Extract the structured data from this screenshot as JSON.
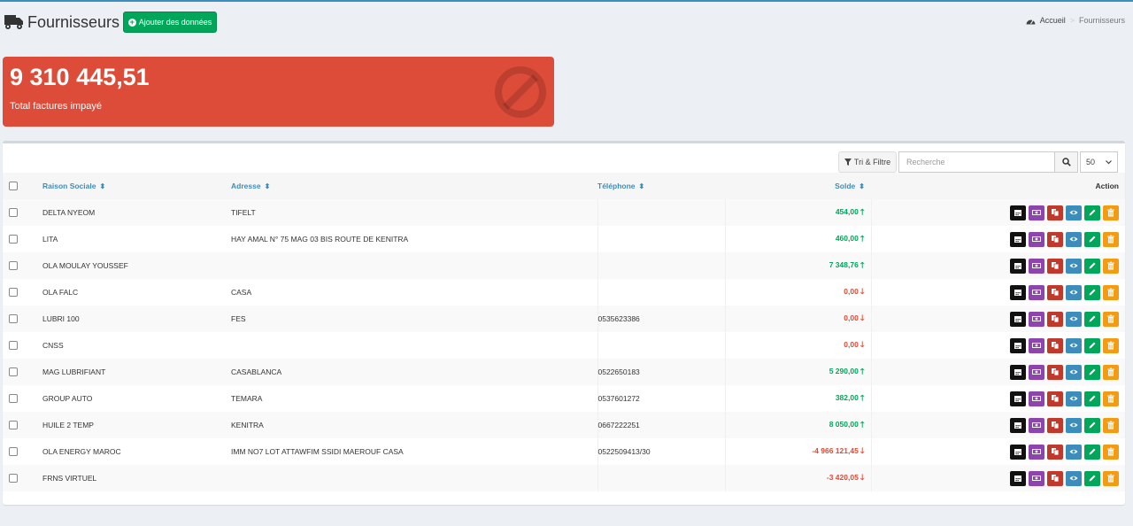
{
  "header": {
    "title": "Fournisseurs",
    "add_button": "Ajouter des données",
    "breadcrumb": {
      "home": "Accueil",
      "current": "Fournisseurs"
    }
  },
  "stat": {
    "value": "9 310 445,51",
    "label": "Total factures impayé"
  },
  "toolbar": {
    "filter_label": "Tri & Filtre",
    "search_placeholder": "Recherche",
    "per_page": "50"
  },
  "table": {
    "headers": {
      "raison": "Raison Sociale",
      "adresse": "Adresse",
      "telephone": "Téléphone",
      "solde": "Solde",
      "action": "Action"
    },
    "rows": [
      {
        "raison": "DELTA NYEOM",
        "adresse": "TIFELT",
        "telephone": "",
        "solde": "454,00",
        "trend": "up"
      },
      {
        "raison": "LITA",
        "adresse": "HAY AMAL N° 75 MAG 03 BIS ROUTE DE KENITRA",
        "telephone": "",
        "solde": "460,00",
        "trend": "up"
      },
      {
        "raison": "OLA MOULAY YOUSSEF",
        "adresse": "",
        "telephone": "",
        "solde": "7 348,76",
        "trend": "up"
      },
      {
        "raison": "OLA FALC",
        "adresse": "CASA",
        "telephone": "",
        "solde": "0,00",
        "trend": "down"
      },
      {
        "raison": "LUBRI 100",
        "adresse": "FES",
        "telephone": "0535623386",
        "solde": "0,00",
        "trend": "down"
      },
      {
        "raison": "CNSS",
        "adresse": "",
        "telephone": "",
        "solde": "0,00",
        "trend": "down"
      },
      {
        "raison": "MAG LUBRIFIANT",
        "adresse": "CASABLANCA",
        "telephone": "0522650183",
        "solde": "5 290,00",
        "trend": "up"
      },
      {
        "raison": "GROUP AUTO",
        "adresse": "TEMARA",
        "telephone": "0537601272",
        "solde": "382,00",
        "trend": "up"
      },
      {
        "raison": "HUILE 2 TEMP",
        "adresse": "KENITRA",
        "telephone": "0667222251",
        "solde": "8 050,00",
        "trend": "up"
      },
      {
        "raison": "OLA ENERGY MAROC",
        "adresse": "IMM NO7 LOT ATTAWFIM SSIDI MAEROUF CASA",
        "telephone": "0522509413/30",
        "solde": "-4 966 121,45",
        "trend": "down"
      },
      {
        "raison": "FRNS VIRTUEL",
        "adresse": "",
        "telephone": "",
        "solde": "-3 420,05",
        "trend": "down"
      }
    ]
  },
  "colors": {
    "accent": "#3c8dbc",
    "danger": "#dd4b39",
    "success": "#00a65a",
    "warning": "#f39c12",
    "purple": "#8e44ad"
  },
  "icons": [
    "truck-icon",
    "plus-circle-icon",
    "dashboard-icon",
    "ban-icon",
    "filter-icon",
    "search-icon",
    "calendar-icon",
    "money-icon",
    "copy-icon",
    "eye-icon",
    "pencil-icon",
    "trash-icon"
  ]
}
